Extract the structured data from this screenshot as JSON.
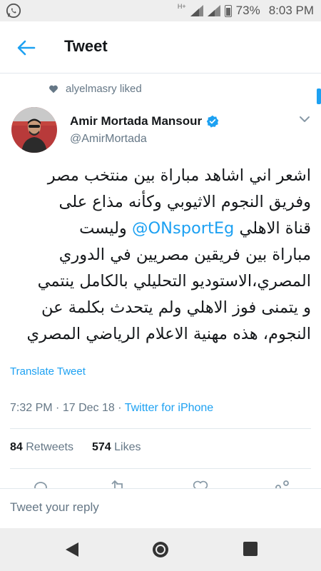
{
  "status_bar": {
    "network": "H+",
    "battery_percent": "73%",
    "time": "8:03 PM"
  },
  "header": {
    "title": "Tweet"
  },
  "liked_by": "alyelmasry liked",
  "author": {
    "name": "Amir Mortada Mansour",
    "handle": "@AmirMortada"
  },
  "tweet": {
    "line1": "اشعر اني اشاهد مباراة بين منتخب مصر",
    "line2": "وفريق النجوم الاثيوبي وكأنه مذاع على",
    "line3_pre": "قناة الاهلي ",
    "mention": "@ONsportEg",
    "line3_post": " وليست",
    "line4": "مباراة بين فريقين مصريين في الدوري",
    "line5": "المصري،الاستوديو التحليلي بالكامل ينتمي",
    "line6": "و يتمنى فوز الاهلي ولم يتحدث بكلمة عن",
    "line7": "النجوم، هذه مهنية الاعلام الرياضي المصري"
  },
  "translate_label": "Translate Tweet",
  "meta": {
    "time": "7:32 PM",
    "date": "17 Dec 18",
    "source": "Twitter for iPhone"
  },
  "stats": {
    "retweets_count": "84",
    "retweets_label": "Retweets",
    "likes_count": "574",
    "likes_label": "Likes"
  },
  "reply": {
    "placeholder": "Tweet your reply"
  },
  "colors": {
    "accent": "#1da1f2",
    "muted": "#657786"
  }
}
